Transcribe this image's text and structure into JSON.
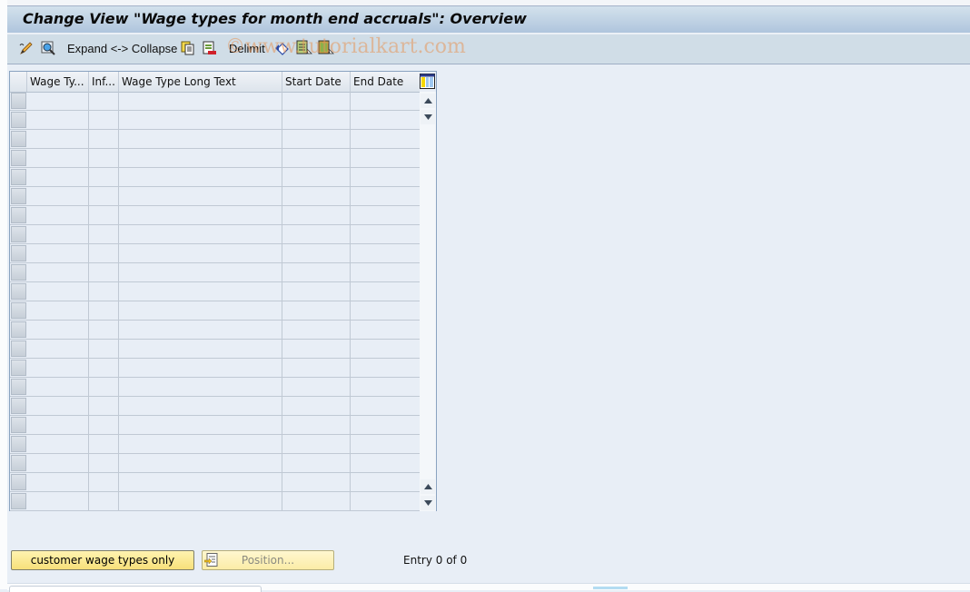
{
  "title": "Change View \"Wage types for month end accruals\": Overview",
  "toolbar": {
    "items": [
      {
        "icon": "display-change-icon",
        "label": ""
      },
      {
        "icon": "find-icon",
        "label": ""
      },
      {
        "label": "Expand <-> Collapse"
      },
      {
        "icon": "copy-as-icon",
        "label": ""
      },
      {
        "icon": "delete-icon",
        "label": ""
      },
      {
        "label": "Delimit"
      },
      {
        "icon": "undo-change-icon",
        "label": ""
      },
      {
        "icon": "select-all-icon",
        "label": ""
      },
      {
        "icon": "select-block-icon",
        "label": ""
      }
    ],
    "expand_collapse_label": "Expand <-> Collapse",
    "delimit_label": "Delimit"
  },
  "watermark": "©www.tutorialkart.com",
  "table": {
    "columns": [
      {
        "label": "Wage Ty..."
      },
      {
        "label": "Inf..."
      },
      {
        "label": "Wage Type Long Text"
      },
      {
        "label": "Start Date"
      },
      {
        "label": "End Date"
      }
    ],
    "row_count": 22,
    "rows": []
  },
  "buttons": {
    "customer_wage_types": "customer wage types only",
    "position": "Position..."
  },
  "entry_text": "Entry 0 of 0",
  "colors": {
    "button_yellow": "#f7e07a",
    "title_bar": "#afc5dd",
    "background": "#e8eef6"
  }
}
